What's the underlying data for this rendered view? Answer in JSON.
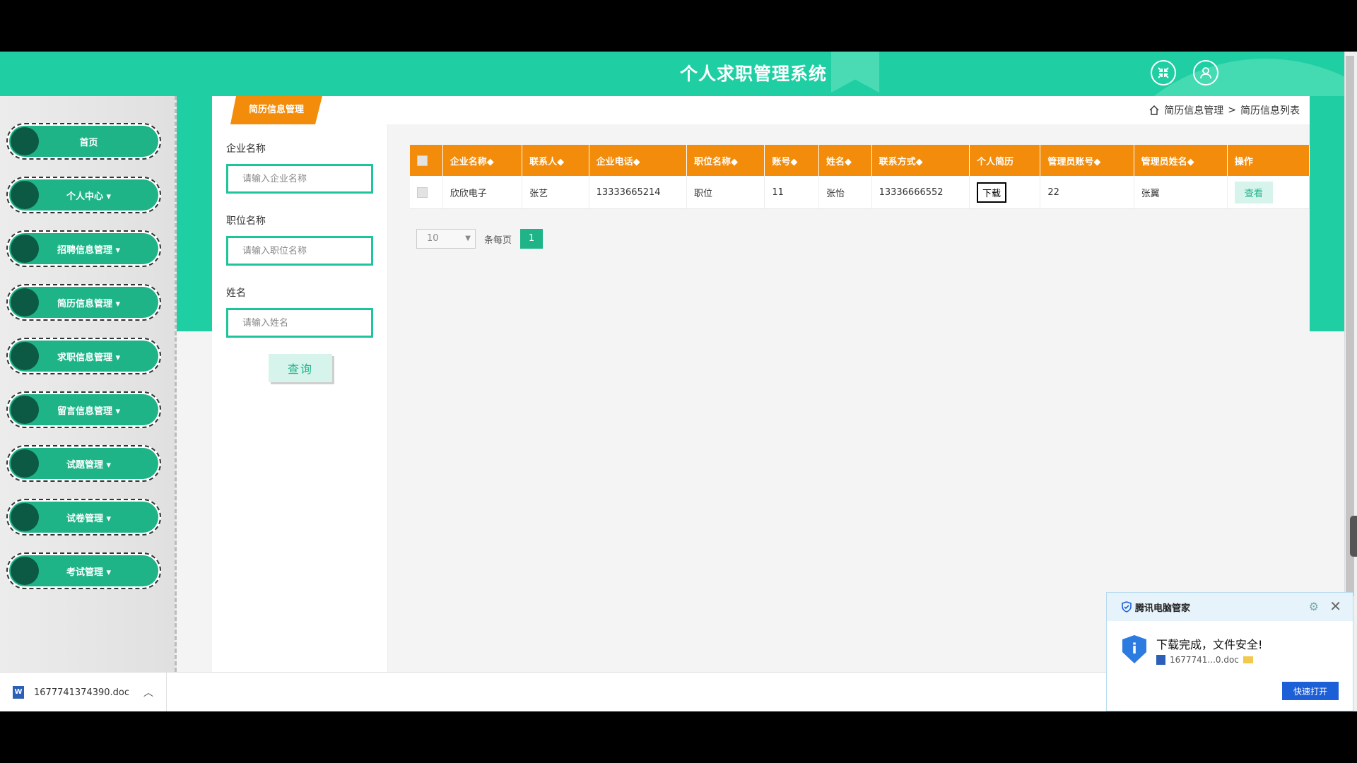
{
  "app": {
    "title": "个人求职管理系统"
  },
  "sidebar": {
    "items": [
      {
        "label": "首页"
      },
      {
        "label": "个人中心 ▾"
      },
      {
        "label": "招聘信息管理 ▾"
      },
      {
        "label": "简历信息管理 ▾"
      },
      {
        "label": "求职信息管理 ▾"
      },
      {
        "label": "留言信息管理 ▾"
      },
      {
        "label": "试题管理 ▾"
      },
      {
        "label": "试卷管理 ▾"
      },
      {
        "label": "考试管理 ▾"
      }
    ]
  },
  "panel": {
    "tab": "简历信息管理",
    "breadcrumb": {
      "level1": "简历信息管理",
      "sep": ">",
      "level2": "简历信息列表"
    }
  },
  "filter": {
    "company": {
      "label": "企业名称",
      "placeholder": "请输入企业名称"
    },
    "position": {
      "label": "职位名称",
      "placeholder": "请输入职位名称"
    },
    "name": {
      "label": "姓名",
      "placeholder": "请输入姓名"
    },
    "query_label": "查询"
  },
  "table": {
    "headers": [
      "企业名称◆",
      "联系人◆",
      "企业电话◆",
      "职位名称◆",
      "账号◆",
      "姓名◆",
      "联系方式◆",
      "个人简历",
      "管理员账号◆",
      "管理员姓名◆",
      "操作"
    ],
    "rows": [
      {
        "company": "欣欣电子",
        "contact": "张艺",
        "phone": "13333665214",
        "position": "职位",
        "account": "11",
        "name": "张怡",
        "mobile": "13336666552",
        "resume": "下载",
        "admin_account": "22",
        "admin_name": "张翼",
        "action": "查看"
      }
    ]
  },
  "pager": {
    "page_size": "10",
    "per_page_label": "条每页",
    "current_page": "1"
  },
  "download_bar": {
    "file_name": "1677741374390.doc"
  },
  "toast": {
    "brand": "腾讯电脑管家",
    "message": "下载完成，文件安全!",
    "file": "1677741...0.doc",
    "open_label": "快速打开"
  },
  "colors": {
    "primary": "#1fcfa3",
    "accent": "#f28c0a",
    "nav": "#1fb488"
  }
}
